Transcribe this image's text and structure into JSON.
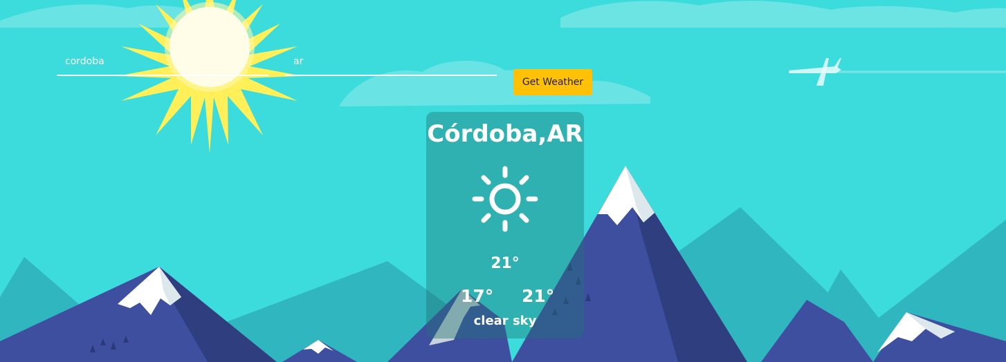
{
  "form": {
    "city_value": "cordoba",
    "city_placeholder": "",
    "country_value": "ar",
    "country_placeholder": "",
    "button_label": "Get Weather"
  },
  "weather": {
    "location": "Córdoba,AR",
    "icon": "sun-icon",
    "temp": "21°",
    "temp_min": "17°",
    "temp_max": "21°",
    "description": "clear sky"
  },
  "colors": {
    "sky": "#3DDCDC",
    "button": "#FFC107",
    "card": "rgba(31, 116, 116, 0.42)",
    "mountain_dark": "#3F4FA0",
    "snow": "#FFFFFF"
  }
}
